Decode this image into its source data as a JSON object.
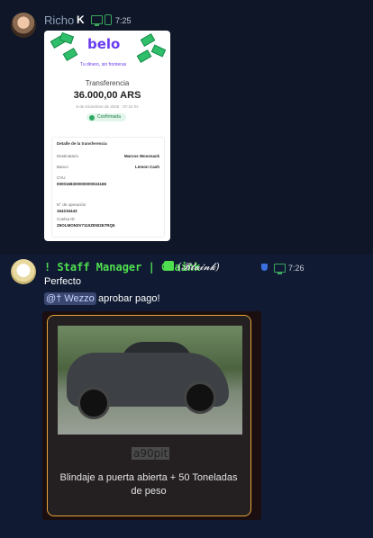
{
  "colors": {
    "background": "#0e1628",
    "accent_green": "#3ba55d",
    "embed_border": "#e8a53a",
    "staff_name": "#4fdf4f"
  },
  "message1": {
    "author": "Richo",
    "badge": "K",
    "time": "7:25",
    "receipt": {
      "logo": "belo",
      "tagline": "Tu dinero, sin fronteras",
      "title": "Transferencia",
      "amount": "36.000,00 ARS",
      "date": "9 de Diciembre de 2025 · 07:24 hs",
      "status": "Confirmada",
      "details_header": "Detalle de la transferencia",
      "fields": [
        {
          "label": "Destinatario",
          "value": "Marcos Wossnack"
        },
        {
          "label": "Banco",
          "value": "Lemon Cash"
        },
        {
          "label": "CVU",
          "value": "0000168300000000024166"
        },
        {
          "label": "N° de operación",
          "value": "164215443"
        },
        {
          "label": "Coelsa ID",
          "value": "Z6OLMON3V7110ZEW2E7RQ5"
        }
      ]
    }
  },
  "message2": {
    "author": "! Staff Manager | Glaink",
    "author_alt": "(𝓑𝓵𝓪𝓲𝓷𝓴)",
    "time": "7:26",
    "line1": "Perfecto",
    "mention": "@† Wezzo",
    "line2_rest": "aprobar pago!",
    "embed": {
      "title": "a90pit",
      "description": "Blindaje a puerta abierta + 50 Toneladas de peso"
    }
  }
}
